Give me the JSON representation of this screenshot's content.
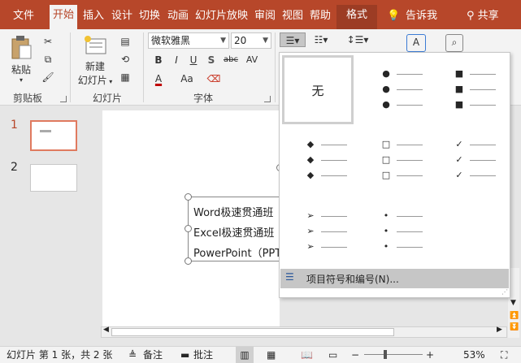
{
  "tabs": [
    {
      "label": "文件"
    },
    {
      "label": "开始"
    },
    {
      "label": "插入"
    },
    {
      "label": "设计"
    },
    {
      "label": "切换"
    },
    {
      "label": "动画"
    },
    {
      "label": "幻灯片放映"
    },
    {
      "label": "审阅"
    },
    {
      "label": "视图"
    },
    {
      "label": "帮助"
    },
    {
      "label": "格式"
    }
  ],
  "tell_me": "告诉我",
  "share": "共享",
  "ribbon": {
    "paste": "粘贴",
    "new_slide_line1": "新建",
    "new_slide_line2": "幻灯片",
    "font_name": "微软雅黑",
    "font_size": "20",
    "groups": {
      "clipboard": "剪贴板",
      "slides": "幻灯片",
      "font": "字体"
    }
  },
  "font_buttons": {
    "bold": "B",
    "italic": "I",
    "underline": "U",
    "shadow": "S",
    "strike": "abc",
    "spacing": "AV",
    "color": "A",
    "case": "Aa"
  },
  "thumbs": [
    {
      "num": "1"
    },
    {
      "num": "2"
    }
  ],
  "slide_text": [
    "Word极速贯通班",
    "Excel极速贯通班",
    "PowerPoint（PPT"
  ],
  "gallery": {
    "none_label": "无",
    "symbols": [
      "●",
      "■",
      "◆",
      "□",
      "✓",
      "➢",
      "•"
    ],
    "footer_label": "项目符号和编号(N)..."
  },
  "status": {
    "slide_info": "幻灯片 第 1 张，共 2 张",
    "notes": "备注",
    "comments": "批注",
    "zoom": "53%"
  },
  "colors": {
    "accent": "#b7472a",
    "font_color_bar": "#c00000"
  }
}
